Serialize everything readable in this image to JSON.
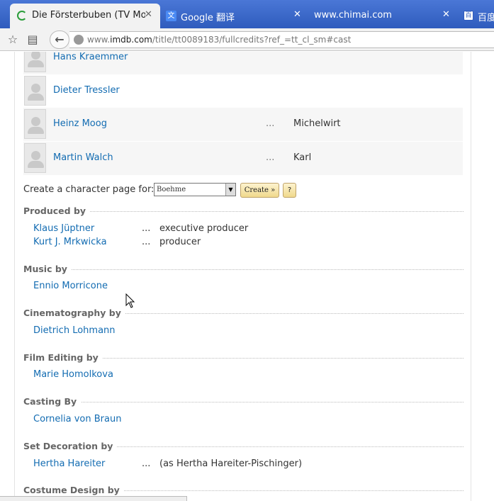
{
  "browser": {
    "tabs": [
      {
        "title": "Die Försterbuben (TV Mo...",
        "active": true
      },
      {
        "title": "Google 翻译",
        "active": false
      },
      {
        "title": "www.chimai.com",
        "active": false
      },
      {
        "title": "百度",
        "active": false
      }
    ],
    "close_glyph": "✕",
    "url": {
      "prefix": "www.",
      "host": "imdb.com",
      "path": "/title/tt0089183/fullcredits?ref_=tt_cl_sm#cast"
    },
    "icons": {
      "back": "back-arrow-icon",
      "star": "star-icon",
      "reader": "reader-icon",
      "globe": "globe-icon"
    }
  },
  "cast": [
    {
      "name": "Hans Kraemmer",
      "dots": "",
      "character": ""
    },
    {
      "name": "Dieter Tressler",
      "dots": "",
      "character": ""
    },
    {
      "name": "Heinz Moog",
      "dots": "...",
      "character": "Michelwirt"
    },
    {
      "name": "Martin Walch",
      "dots": "...",
      "character": "Karl"
    }
  ],
  "character_page": {
    "label": "Create a character page for:",
    "selected": "Boehme",
    "create_button": "Create »",
    "help_button": "?"
  },
  "sections": [
    {
      "title": "Produced by",
      "rows": [
        {
          "name": "Klaus Jüptner",
          "dots": "...",
          "credit": "executive producer"
        },
        {
          "name": "Kurt J. Mrkwicka",
          "dots": "...",
          "credit": "producer"
        }
      ]
    },
    {
      "title": "Music by",
      "rows": [
        {
          "name": "Ennio Morricone",
          "dots": "",
          "credit": ""
        }
      ]
    },
    {
      "title": "Cinematography by",
      "rows": [
        {
          "name": "Dietrich Lohmann",
          "dots": "",
          "credit": ""
        }
      ]
    },
    {
      "title": "Film Editing by",
      "rows": [
        {
          "name": "Marie Homolkova",
          "dots": "",
          "credit": ""
        }
      ]
    },
    {
      "title": "Casting By",
      "rows": [
        {
          "name": "Cornelia von Braun",
          "dots": "",
          "credit": ""
        }
      ]
    },
    {
      "title": "Set Decoration by",
      "rows": [
        {
          "name": "Hertha Hareiter",
          "dots": "...",
          "credit": "(as Hertha Hareiter-Pischinger)"
        }
      ]
    },
    {
      "title": "Costume Design by",
      "rows": []
    }
  ],
  "colors": {
    "link": "#136cb2",
    "tabstrip": "#2f5cbd"
  }
}
